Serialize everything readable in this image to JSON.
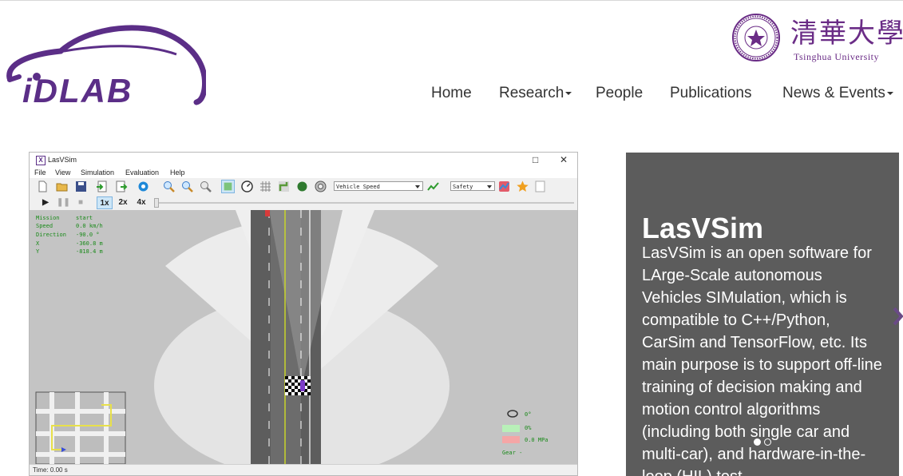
{
  "header": {
    "logo_text": "iDLAB",
    "university_cn": "清華大學",
    "university_en": "Tsinghua University"
  },
  "nav": [
    {
      "label": "Home",
      "dropdown": false
    },
    {
      "label": "Research",
      "dropdown": true
    },
    {
      "label": "People",
      "dropdown": false
    },
    {
      "label": "Publications",
      "dropdown": false
    },
    {
      "label": "News & Events",
      "dropdown": true
    }
  ],
  "app": {
    "title": "LasVSim",
    "window_buttons": {
      "maximize": "□",
      "close": "✕"
    },
    "menu": [
      "File",
      "View",
      "Simulation",
      "Evaluation",
      "Help"
    ],
    "combo_signal": "Vehicle Speed",
    "combo_eval": "Safety",
    "speeds": [
      "1x",
      "2x",
      "4x"
    ],
    "info": {
      "rows": [
        {
          "label": "Mission",
          "value": "start"
        },
        {
          "label": "Speed",
          "value": "0.0 km/h"
        },
        {
          "label": "Direction",
          "value": "-90.0 °"
        },
        {
          "label": "X",
          "value": "-360.8 m"
        },
        {
          "label": "Y",
          "value": "-818.4 m"
        }
      ]
    },
    "gauges": {
      "steering": "0°",
      "throttle": "0%",
      "brake": "0.0 MPa",
      "gear": "Gear  -"
    },
    "status": "Time: 0.00 s"
  },
  "carousel": {
    "title": "LasVSim",
    "body": "LasVSim is an open software for LArge-Scale autonomous Vehicles SIMulation, which is compatible to C++/Python, CarSim and TensorFlow, etc. Its main purpose is to support off-line training of decision making and motion control algorithms (including both single car and multi-car), and hardware-in-the-loop (HIL) test.",
    "active_slide": 0,
    "slides": 2
  },
  "colors": {
    "brand_purple": "#5b2e87",
    "panel_bg": "#5c5c5c",
    "info_green": "#1a8a1a"
  }
}
